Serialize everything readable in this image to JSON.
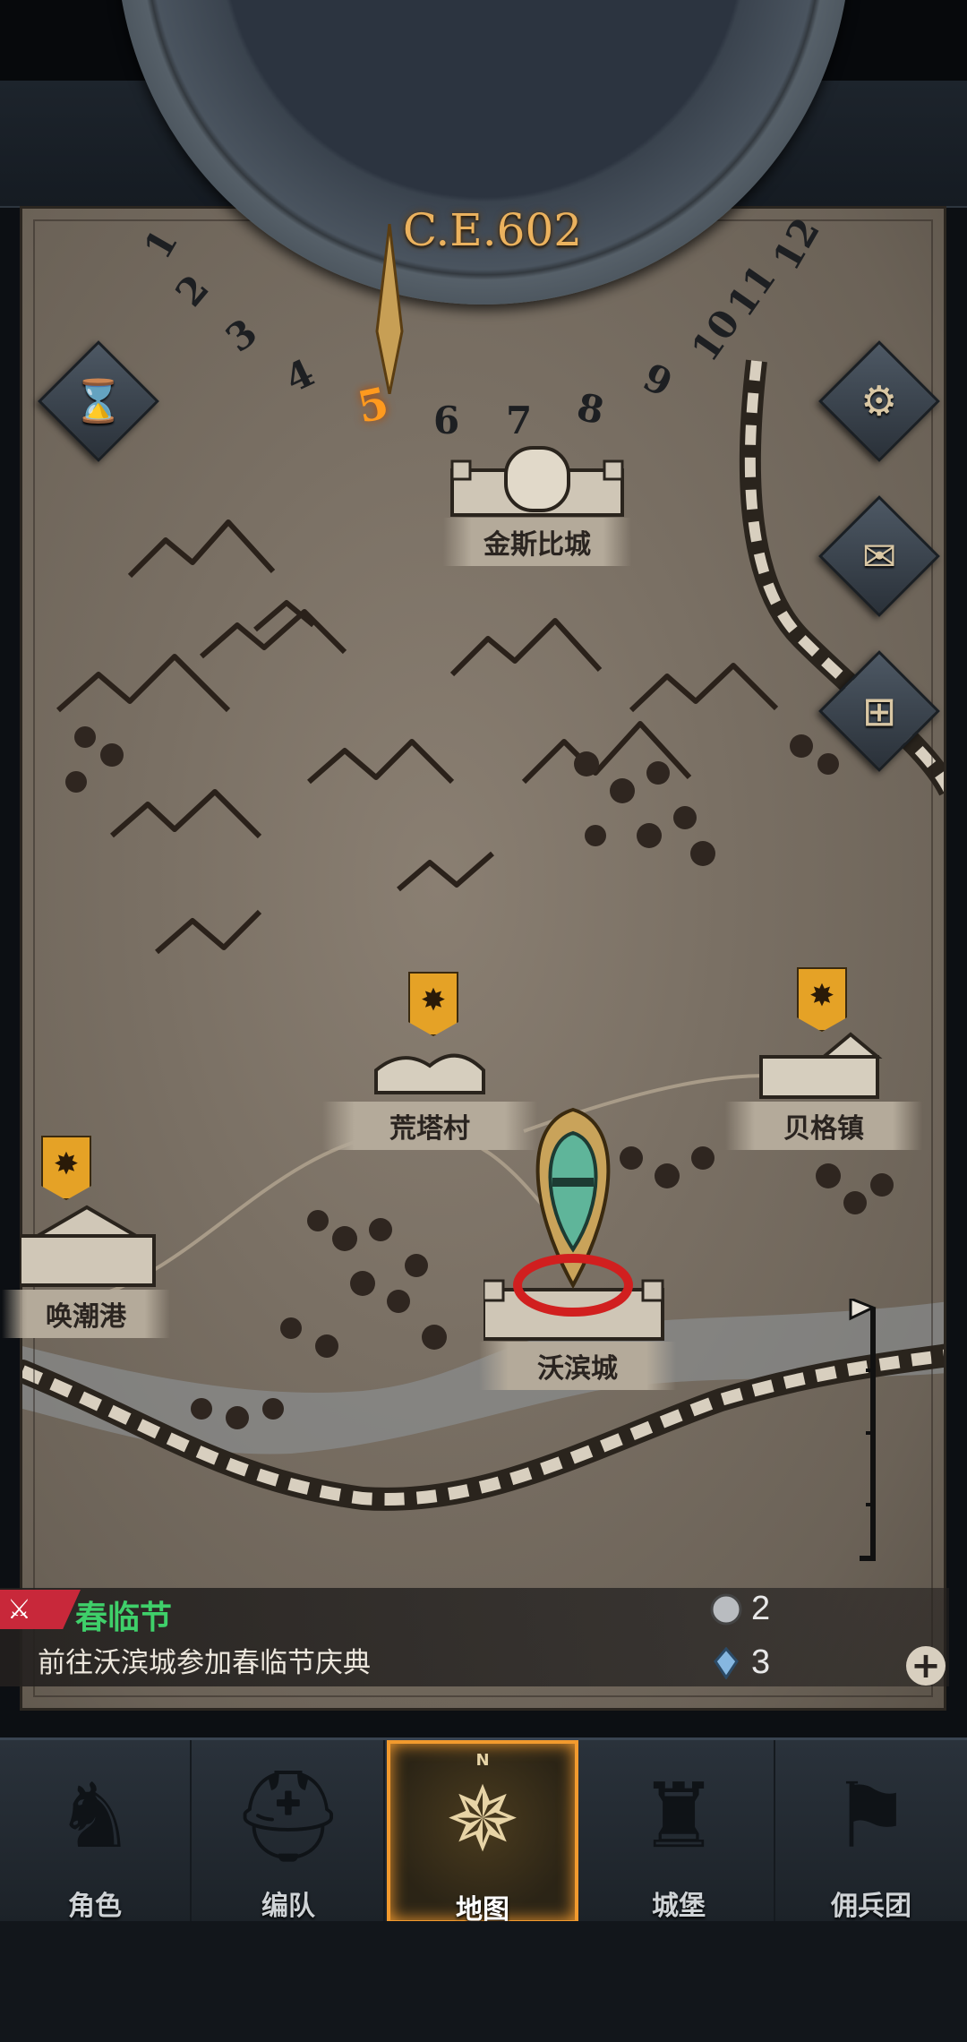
{
  "calendar": {
    "year": "C.E.602",
    "months": [
      "1",
      "2",
      "3",
      "4",
      "5",
      "6",
      "7",
      "8",
      "9",
      "10",
      "11",
      "12"
    ],
    "current_month": "5"
  },
  "side_buttons": [
    {
      "name": "settings",
      "icon": "gear-icon",
      "glyph": "⚙"
    },
    {
      "name": "mail",
      "icon": "envelope-icon",
      "glyph": "✉"
    },
    {
      "name": "grid",
      "icon": "window-icon",
      "glyph": "⊞"
    }
  ],
  "time_button": {
    "icon": "hourglass-icon",
    "glyph": "⌛"
  },
  "towns": {
    "kingsbi": {
      "label": "金斯比城"
    },
    "huangta": {
      "label": "荒塔村"
    },
    "beige": {
      "label": "贝格镇"
    },
    "huanchao": {
      "label": "唤潮港"
    },
    "wobin": {
      "label": "沃滨城"
    }
  },
  "quest": {
    "tag_icon": "crossed-swords-icon",
    "title": "春临节",
    "description": "前往沃滨城参加春临节庆典"
  },
  "resources": {
    "silver": {
      "icon": "silver-coin-icon",
      "value": "2"
    },
    "crystal": {
      "icon": "crystal-icon",
      "value": "3"
    }
  },
  "nav": {
    "items": [
      {
        "label": "角色",
        "icon": "knight-icon",
        "glyph": "♞"
      },
      {
        "label": "编队",
        "icon": "helmet-icon",
        "glyph": "⛑"
      },
      {
        "label": "地图",
        "icon": "compass-icon",
        "glyph": "✵"
      },
      {
        "label": "城堡",
        "icon": "castle-icon",
        "glyph": "♜"
      },
      {
        "label": "佣兵团",
        "icon": "mercenary-flag-icon",
        "glyph": "⚑"
      }
    ],
    "active": "地图",
    "compass_n": "N"
  }
}
